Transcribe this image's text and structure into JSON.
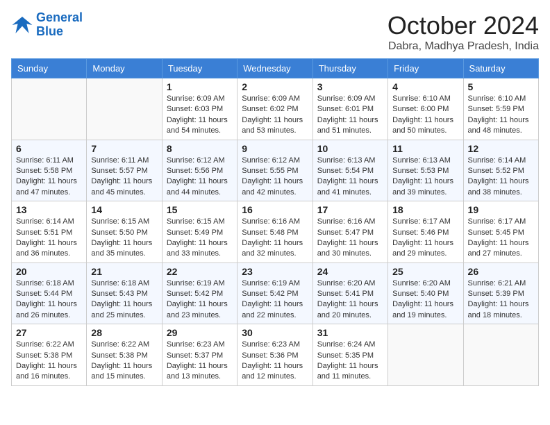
{
  "header": {
    "logo_line1": "General",
    "logo_line2": "Blue",
    "month": "October 2024",
    "location": "Dabra, Madhya Pradesh, India"
  },
  "weekdays": [
    "Sunday",
    "Monday",
    "Tuesday",
    "Wednesday",
    "Thursday",
    "Friday",
    "Saturday"
  ],
  "weeks": [
    [
      {
        "day": "",
        "info": ""
      },
      {
        "day": "",
        "info": ""
      },
      {
        "day": "1",
        "info": "Sunrise: 6:09 AM\nSunset: 6:03 PM\nDaylight: 11 hours and 54 minutes."
      },
      {
        "day": "2",
        "info": "Sunrise: 6:09 AM\nSunset: 6:02 PM\nDaylight: 11 hours and 53 minutes."
      },
      {
        "day": "3",
        "info": "Sunrise: 6:09 AM\nSunset: 6:01 PM\nDaylight: 11 hours and 51 minutes."
      },
      {
        "day": "4",
        "info": "Sunrise: 6:10 AM\nSunset: 6:00 PM\nDaylight: 11 hours and 50 minutes."
      },
      {
        "day": "5",
        "info": "Sunrise: 6:10 AM\nSunset: 5:59 PM\nDaylight: 11 hours and 48 minutes."
      }
    ],
    [
      {
        "day": "6",
        "info": "Sunrise: 6:11 AM\nSunset: 5:58 PM\nDaylight: 11 hours and 47 minutes."
      },
      {
        "day": "7",
        "info": "Sunrise: 6:11 AM\nSunset: 5:57 PM\nDaylight: 11 hours and 45 minutes."
      },
      {
        "day": "8",
        "info": "Sunrise: 6:12 AM\nSunset: 5:56 PM\nDaylight: 11 hours and 44 minutes."
      },
      {
        "day": "9",
        "info": "Sunrise: 6:12 AM\nSunset: 5:55 PM\nDaylight: 11 hours and 42 minutes."
      },
      {
        "day": "10",
        "info": "Sunrise: 6:13 AM\nSunset: 5:54 PM\nDaylight: 11 hours and 41 minutes."
      },
      {
        "day": "11",
        "info": "Sunrise: 6:13 AM\nSunset: 5:53 PM\nDaylight: 11 hours and 39 minutes."
      },
      {
        "day": "12",
        "info": "Sunrise: 6:14 AM\nSunset: 5:52 PM\nDaylight: 11 hours and 38 minutes."
      }
    ],
    [
      {
        "day": "13",
        "info": "Sunrise: 6:14 AM\nSunset: 5:51 PM\nDaylight: 11 hours and 36 minutes."
      },
      {
        "day": "14",
        "info": "Sunrise: 6:15 AM\nSunset: 5:50 PM\nDaylight: 11 hours and 35 minutes."
      },
      {
        "day": "15",
        "info": "Sunrise: 6:15 AM\nSunset: 5:49 PM\nDaylight: 11 hours and 33 minutes."
      },
      {
        "day": "16",
        "info": "Sunrise: 6:16 AM\nSunset: 5:48 PM\nDaylight: 11 hours and 32 minutes."
      },
      {
        "day": "17",
        "info": "Sunrise: 6:16 AM\nSunset: 5:47 PM\nDaylight: 11 hours and 30 minutes."
      },
      {
        "day": "18",
        "info": "Sunrise: 6:17 AM\nSunset: 5:46 PM\nDaylight: 11 hours and 29 minutes."
      },
      {
        "day": "19",
        "info": "Sunrise: 6:17 AM\nSunset: 5:45 PM\nDaylight: 11 hours and 27 minutes."
      }
    ],
    [
      {
        "day": "20",
        "info": "Sunrise: 6:18 AM\nSunset: 5:44 PM\nDaylight: 11 hours and 26 minutes."
      },
      {
        "day": "21",
        "info": "Sunrise: 6:18 AM\nSunset: 5:43 PM\nDaylight: 11 hours and 25 minutes."
      },
      {
        "day": "22",
        "info": "Sunrise: 6:19 AM\nSunset: 5:42 PM\nDaylight: 11 hours and 23 minutes."
      },
      {
        "day": "23",
        "info": "Sunrise: 6:19 AM\nSunset: 5:42 PM\nDaylight: 11 hours and 22 minutes."
      },
      {
        "day": "24",
        "info": "Sunrise: 6:20 AM\nSunset: 5:41 PM\nDaylight: 11 hours and 20 minutes."
      },
      {
        "day": "25",
        "info": "Sunrise: 6:20 AM\nSunset: 5:40 PM\nDaylight: 11 hours and 19 minutes."
      },
      {
        "day": "26",
        "info": "Sunrise: 6:21 AM\nSunset: 5:39 PM\nDaylight: 11 hours and 18 minutes."
      }
    ],
    [
      {
        "day": "27",
        "info": "Sunrise: 6:22 AM\nSunset: 5:38 PM\nDaylight: 11 hours and 16 minutes."
      },
      {
        "day": "28",
        "info": "Sunrise: 6:22 AM\nSunset: 5:38 PM\nDaylight: 11 hours and 15 minutes."
      },
      {
        "day": "29",
        "info": "Sunrise: 6:23 AM\nSunset: 5:37 PM\nDaylight: 11 hours and 13 minutes."
      },
      {
        "day": "30",
        "info": "Sunrise: 6:23 AM\nSunset: 5:36 PM\nDaylight: 11 hours and 12 minutes."
      },
      {
        "day": "31",
        "info": "Sunrise: 6:24 AM\nSunset: 5:35 PM\nDaylight: 11 hours and 11 minutes."
      },
      {
        "day": "",
        "info": ""
      },
      {
        "day": "",
        "info": ""
      }
    ]
  ]
}
